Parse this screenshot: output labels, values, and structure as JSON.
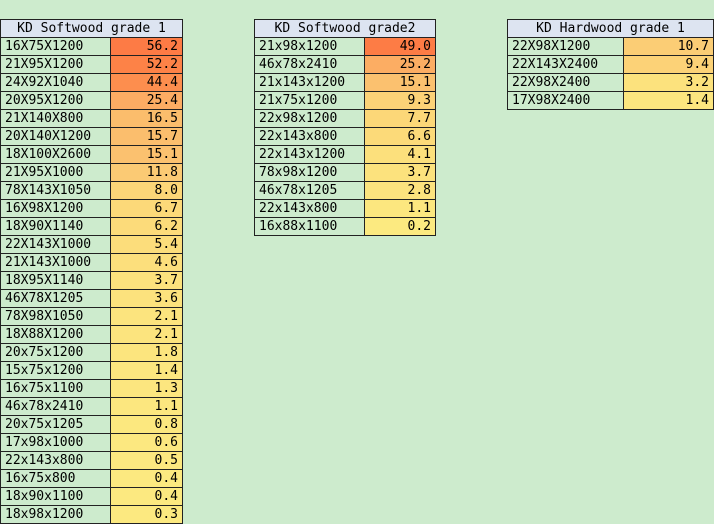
{
  "tables": [
    {
      "title": "KD Softwood grade 1",
      "rows": [
        {
          "name": "16X75X1200",
          "value": "56.2",
          "color": "#fd7b45"
        },
        {
          "name": "21X95X1200",
          "value": "52.2",
          "color": "#fd8247"
        },
        {
          "name": "24X92X1040",
          "value": "44.4",
          "color": "#fd8e4e"
        },
        {
          "name": "20X95X1200",
          "value": "25.4",
          "color": "#fcac63"
        },
        {
          "name": "21X140X800",
          "value": "16.5",
          "color": "#fbbd6c"
        },
        {
          "name": "20X140X1200",
          "value": "15.7",
          "color": "#fbbe6d"
        },
        {
          "name": "18X100X2600",
          "value": "15.1",
          "color": "#fbc16f"
        },
        {
          "name": "21X95X1000",
          "value": "11.8",
          "color": "#fbca74"
        },
        {
          "name": "78X143X1050",
          "value": "8.0",
          "color": "#fcd678"
        },
        {
          "name": "16X98X1200",
          "value": "6.7",
          "color": "#fcd979"
        },
        {
          "name": "18X90X1140",
          "value": "6.2",
          "color": "#fcdb7a"
        },
        {
          "name": "22X143X1000",
          "value": "5.4",
          "color": "#fcdd7b"
        },
        {
          "name": "21X143X1000",
          "value": "4.6",
          "color": "#fcdf7c"
        },
        {
          "name": "18X95X1140",
          "value": "3.7",
          "color": "#fce27d"
        },
        {
          "name": "46X78X1205",
          "value": "3.6",
          "color": "#fce27d"
        },
        {
          "name": "78X98X1050",
          "value": "2.1",
          "color": "#fce47e"
        },
        {
          "name": "18X88X1200",
          "value": "2.1",
          "color": "#fce47e"
        },
        {
          "name": "20x75x1200",
          "value": "1.8",
          "color": "#fce57e"
        },
        {
          "name": "15x75x1200",
          "value": "1.4",
          "color": "#fce67f"
        },
        {
          "name": "16x75x1100",
          "value": "1.3",
          "color": "#fce67f"
        },
        {
          "name": "46x78x2410",
          "value": "1.1",
          "color": "#fce77f"
        },
        {
          "name": "20x75x1205",
          "value": "0.8",
          "color": "#fce87f"
        },
        {
          "name": "17x98x1000",
          "value": "0.6",
          "color": "#fce880"
        },
        {
          "name": "22x143x800",
          "value": "0.5",
          "color": "#fce880"
        },
        {
          "name": "16x75x800",
          "value": "0.4",
          "color": "#fce980"
        },
        {
          "name": "18x90x1100",
          "value": "0.4",
          "color": "#fce980"
        },
        {
          "name": "18x98x1200",
          "value": "0.3",
          "color": "#fce980"
        }
      ]
    },
    {
      "title": "KD Softwood grade2",
      "rows": [
        {
          "name": "21x98x1200",
          "value": "49.0",
          "color": "#fd7c45"
        },
        {
          "name": "46x78x2410",
          "value": "25.2",
          "color": "#fcad63"
        },
        {
          "name": "21x143x1200",
          "value": "15.1",
          "color": "#fbc16f"
        },
        {
          "name": "21x75x1200",
          "value": "9.3",
          "color": "#fcd277"
        },
        {
          "name": "22x98x1200",
          "value": "7.7",
          "color": "#fcd778"
        },
        {
          "name": "22x143x800",
          "value": "6.6",
          "color": "#fcda79"
        },
        {
          "name": "22x143x1200",
          "value": "4.1",
          "color": "#fce07c"
        },
        {
          "name": "78x98x1200",
          "value": "3.7",
          "color": "#fce27d"
        },
        {
          "name": "46x78x1205",
          "value": "2.8",
          "color": "#fce37e"
        },
        {
          "name": "22x143x800",
          "value": "1.1",
          "color": "#fce77f"
        },
        {
          "name": "16x88x1100",
          "value": "0.2",
          "color": "#fcea80"
        }
      ]
    },
    {
      "title": "KD Hardwood grade 1",
      "rows": [
        {
          "name": "22X98X1200",
          "value": "10.7",
          "color": "#fbcd75"
        },
        {
          "name": "22X143X2400",
          "value": "9.4",
          "color": "#fcd277"
        },
        {
          "name": "22X98X2400",
          "value": "3.2",
          "color": "#fce27d"
        },
        {
          "name": "17X98X2400",
          "value": "1.4",
          "color": "#fce67f"
        }
      ]
    }
  ]
}
